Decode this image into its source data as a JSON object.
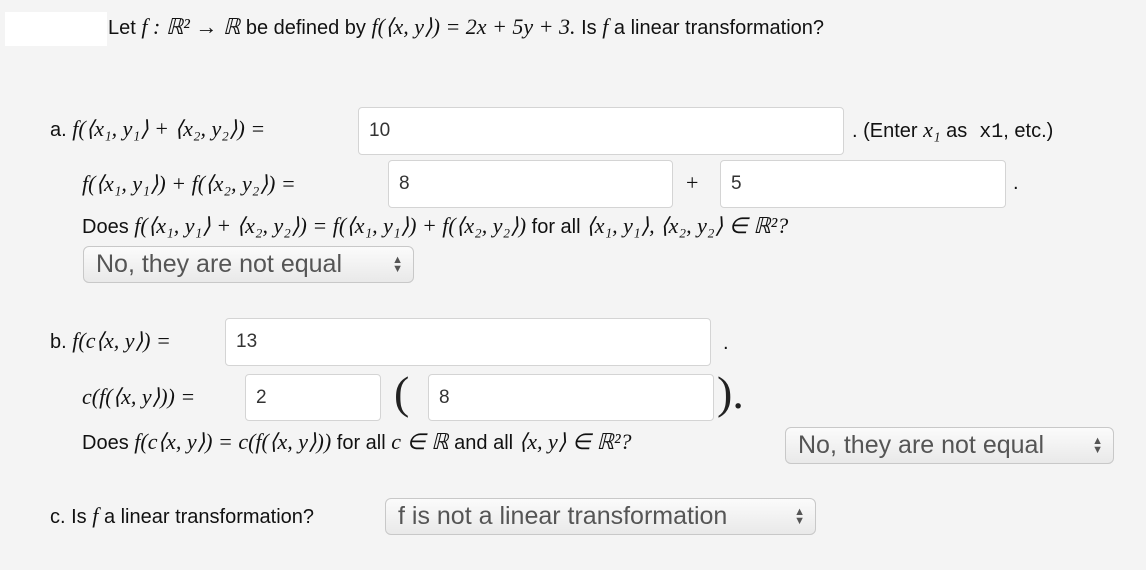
{
  "question": {
    "lead": "Let",
    "math_map": "f : ℝ² → ℝ",
    "mid": "be defined by",
    "math_def": "f(⟨x, y⟩) = 2x + 5y + 3.",
    "tail_is": "Is",
    "math_f": "f",
    "tail": "a linear transformation?"
  },
  "part_a": {
    "label": "a.",
    "lhs1": "f(⟨x₁, y₁⟩ + ⟨x₂, y₂⟩) =",
    "input1": "10",
    "hint_pre": ". (Enter",
    "hint_math": "x₁",
    "hint_mid": "as",
    "hint_code": "x1",
    "hint_post": ", etc.)",
    "lhs2": "f(⟨x₁, y₁⟩) + f(⟨x₂, y₂⟩) =",
    "input2": "8",
    "plus": "+",
    "input3": "5",
    "period": ".",
    "does": "Does",
    "does_math": "f(⟨x₁, y₁⟩ + ⟨x₂, y₂⟩) = f(⟨x₁, y₁⟩) + f(⟨x₂, y₂⟩)",
    "for_all": "for all",
    "for_all_math": "⟨x₁, y₁⟩, ⟨x₂, y₂⟩ ∈ ℝ²?",
    "select": "No, they are not equal"
  },
  "part_b": {
    "label": "b.",
    "lhs1": "f(c⟨x, y⟩) =",
    "input1": "13",
    "period": ".",
    "lhs2": "c(f(⟨x, y⟩)) =",
    "input2": "2",
    "open_paren": "(",
    "input3": "8",
    "close_paren": ").",
    "does": "Does",
    "does_math": "f(c⟨x, y⟩) = c(f(⟨x, y⟩))",
    "for_all": "for all",
    "c_math": "c ∈ ℝ",
    "and_all": "and all",
    "xy_math": "⟨x, y⟩ ∈ ℝ²?",
    "select": "No, they are not equal"
  },
  "part_c": {
    "label": "c.",
    "is": "Is",
    "math_f": "f",
    "question": "a linear transformation?",
    "select": "f is not a linear transformation"
  }
}
